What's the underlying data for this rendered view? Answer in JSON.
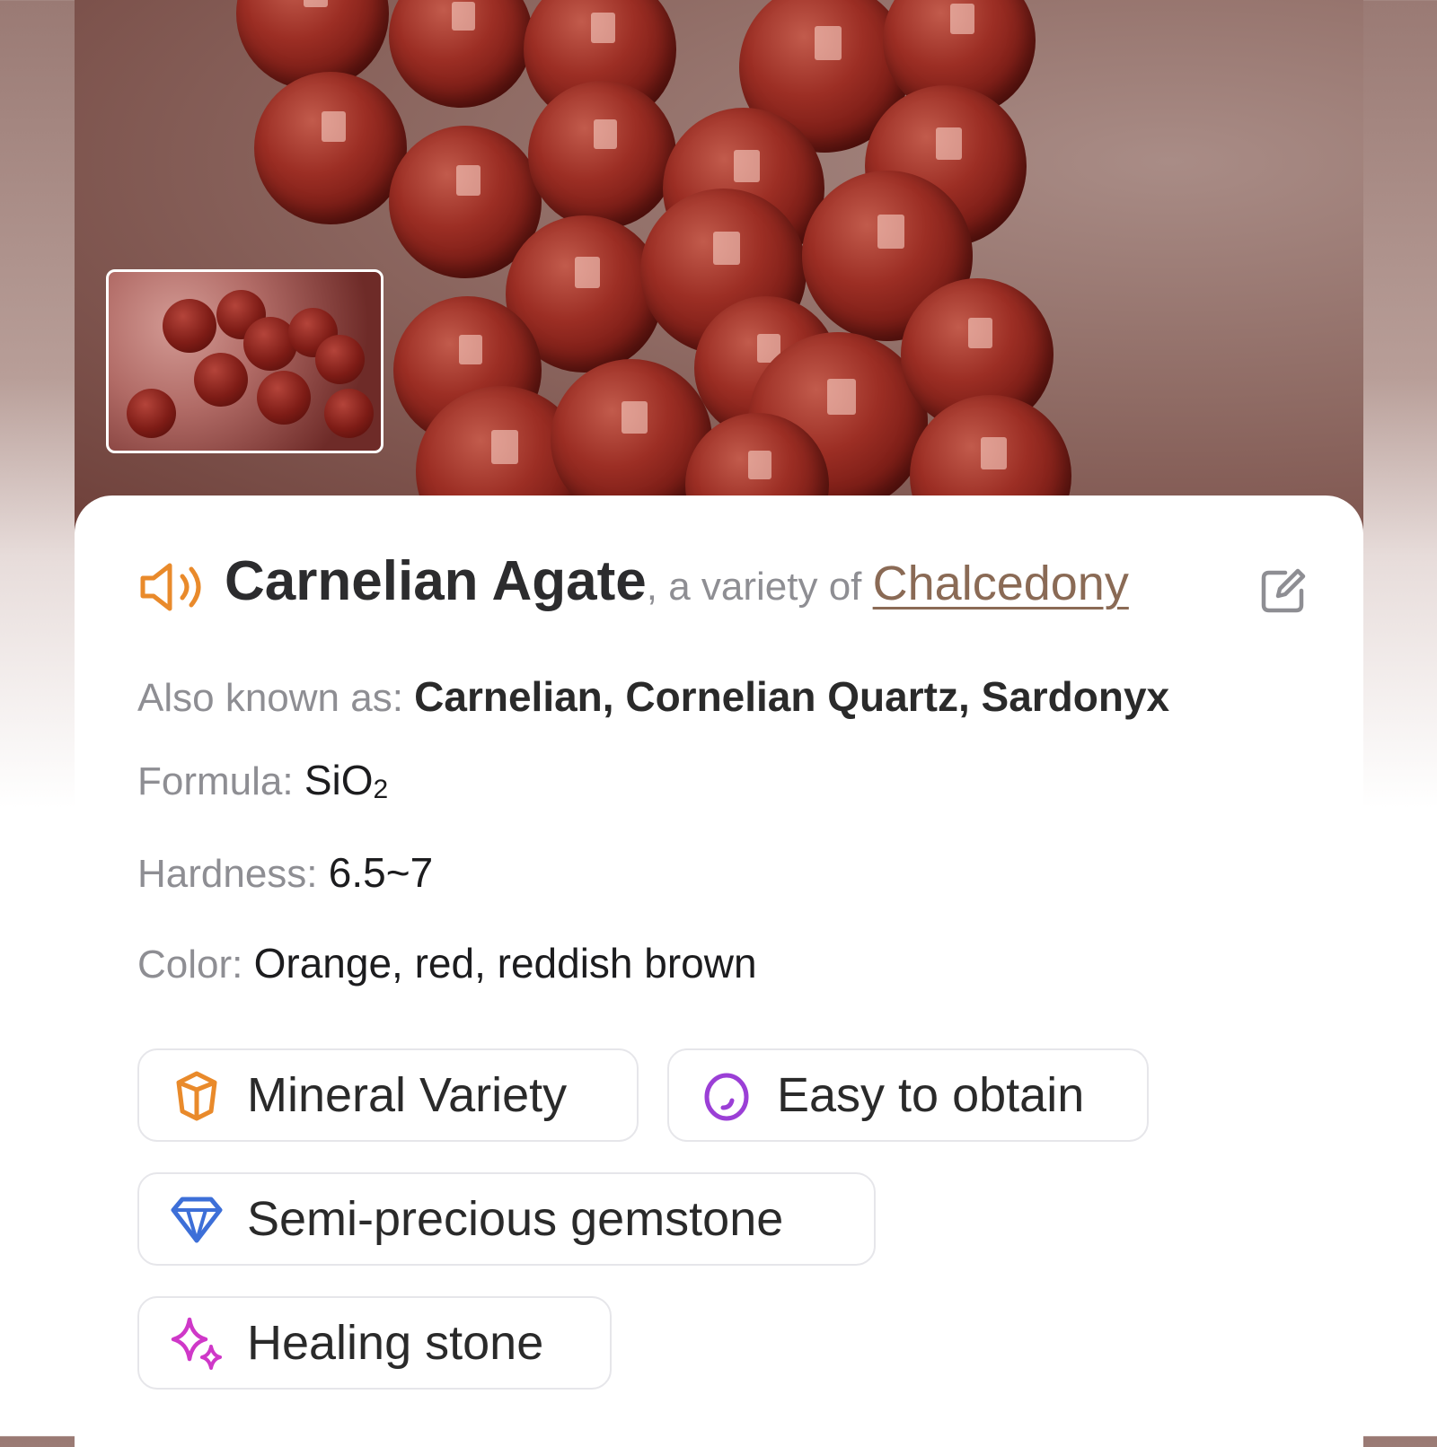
{
  "photo": {
    "description_icon": "beads-photo"
  },
  "header": {
    "name": "Carnelian Agate",
    "comma": ",",
    "variety_prefix": " a variety of ",
    "variety_link": "Chalcedony"
  },
  "properties": {
    "also_known_label": "Also known as: ",
    "also_known_value": "Carnelian, Cornelian Quartz, Sardonyx",
    "formula_label": "Formula: ",
    "formula_value": "SiO",
    "formula_sub": "2",
    "hardness_label": "Hardness: ",
    "hardness_value": "6.5~7",
    "color_label": "Color: ",
    "color_value": "Orange, red, reddish brown"
  },
  "tags": [
    {
      "label": "Mineral Variety",
      "icon": "crystal-icon",
      "color": "#e98a2b"
    },
    {
      "label": "Easy to obtain",
      "icon": "stone-icon",
      "color": "#9b3fd6"
    },
    {
      "label": "Semi-precious gemstone",
      "icon": "diamond-icon",
      "color": "#3d6fd8"
    },
    {
      "label": "Healing stone",
      "icon": "sparkle-icon",
      "color": "#cf38c8"
    }
  ],
  "colors": {
    "accent_orange": "#e98a2b",
    "link_brown": "#8a6a55"
  }
}
